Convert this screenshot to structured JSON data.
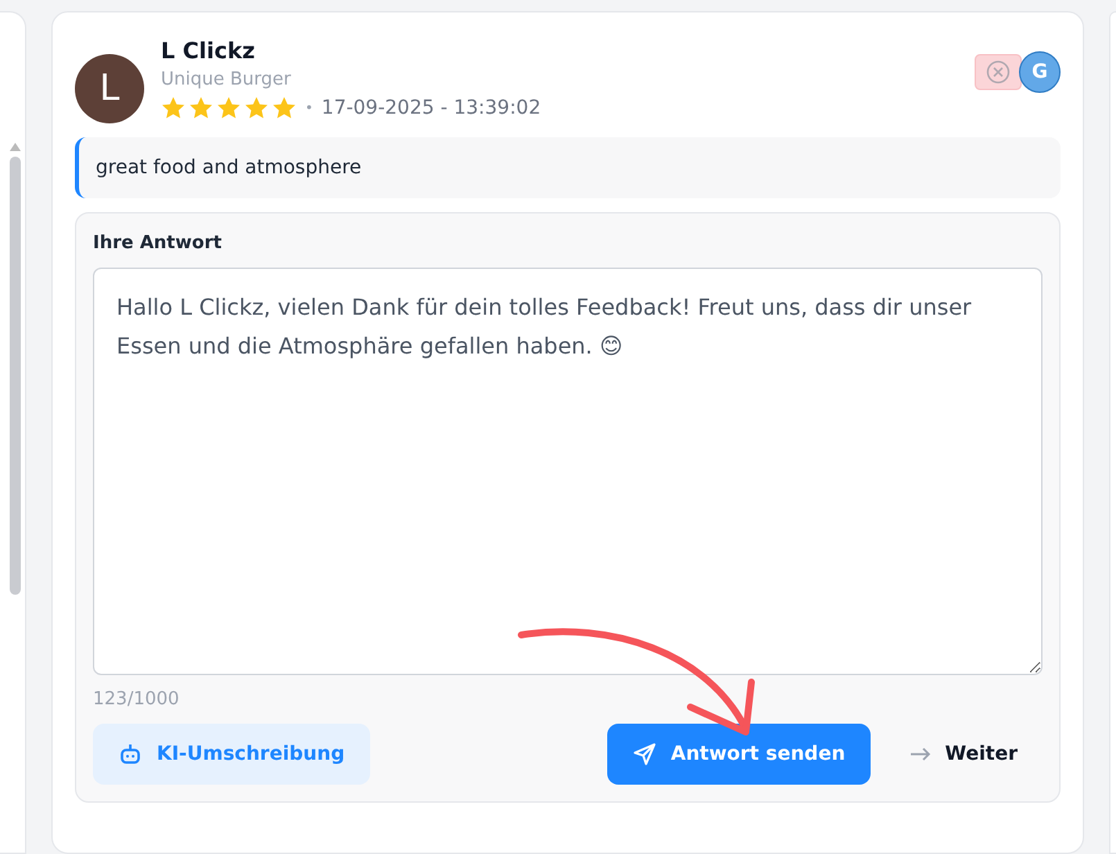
{
  "review": {
    "author": "L Clickz",
    "avatar_letter": "L",
    "business": "Unique Burger",
    "stars": 5,
    "separator": "•",
    "date": "17-09-2025 - 13:39:02",
    "source_badge": "G",
    "text": "great food and atmosphere"
  },
  "reply": {
    "label": "Ihre Antwort",
    "value": "Hallo L Clickz, vielen Dank für dein tolles Feedback! Freut uns, dass dir unser Essen und die Atmosphäre gefallen haben. 😊",
    "counter": "123/1000"
  },
  "buttons": {
    "rewrite": "KI-Umschreibung",
    "send": "Antwort senden",
    "next": "Weiter"
  }
}
